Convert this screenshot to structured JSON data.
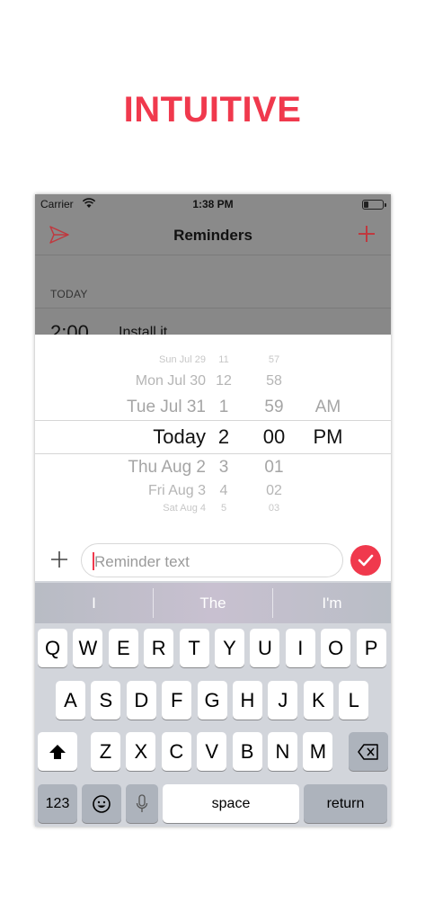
{
  "headline": "INTUITIVE",
  "colors": {
    "accent": "#f0394d",
    "dim_overlay": "#8a8a8a",
    "keyboard_bg": "#d2d5db"
  },
  "status_bar": {
    "carrier": "Carrier",
    "time": "1:38 PM",
    "battery_level": 0.25
  },
  "nav": {
    "title": "Reminders",
    "left_icon": "send-icon",
    "right_icon": "plus-icon"
  },
  "list": {
    "section": "TODAY",
    "rows": [
      {
        "time": "2:00",
        "text": "Install it"
      }
    ]
  },
  "picker": {
    "dates": [
      "Sun Jul 29",
      "Mon Jul 30",
      "Tue Jul 31",
      "Today",
      "Thu Aug 2",
      "Fri Aug 3",
      "Sat Aug 4"
    ],
    "hours": [
      "11",
      "12",
      "1",
      "2",
      "3",
      "4",
      "5"
    ],
    "minutes": [
      "57",
      "58",
      "59",
      "00",
      "01",
      "02",
      "03"
    ],
    "ampm": [
      "AM",
      "PM"
    ],
    "selected": {
      "date": "Today",
      "hour": "2",
      "minute": "00",
      "ampm": "PM"
    }
  },
  "input": {
    "placeholder": "Reminder text",
    "add_icon": "plus-icon",
    "submit_icon": "check-icon"
  },
  "keyboard": {
    "suggestions": [
      "I",
      "The",
      "I'm"
    ],
    "row1": [
      "Q",
      "W",
      "E",
      "R",
      "T",
      "Y",
      "U",
      "I",
      "O",
      "P"
    ],
    "row2": [
      "A",
      "S",
      "D",
      "F",
      "G",
      "H",
      "J",
      "K",
      "L"
    ],
    "row3": [
      "Z",
      "X",
      "C",
      "V",
      "B",
      "N",
      "M"
    ],
    "numbers_label": "123",
    "space_label": "space",
    "return_label": "return"
  }
}
